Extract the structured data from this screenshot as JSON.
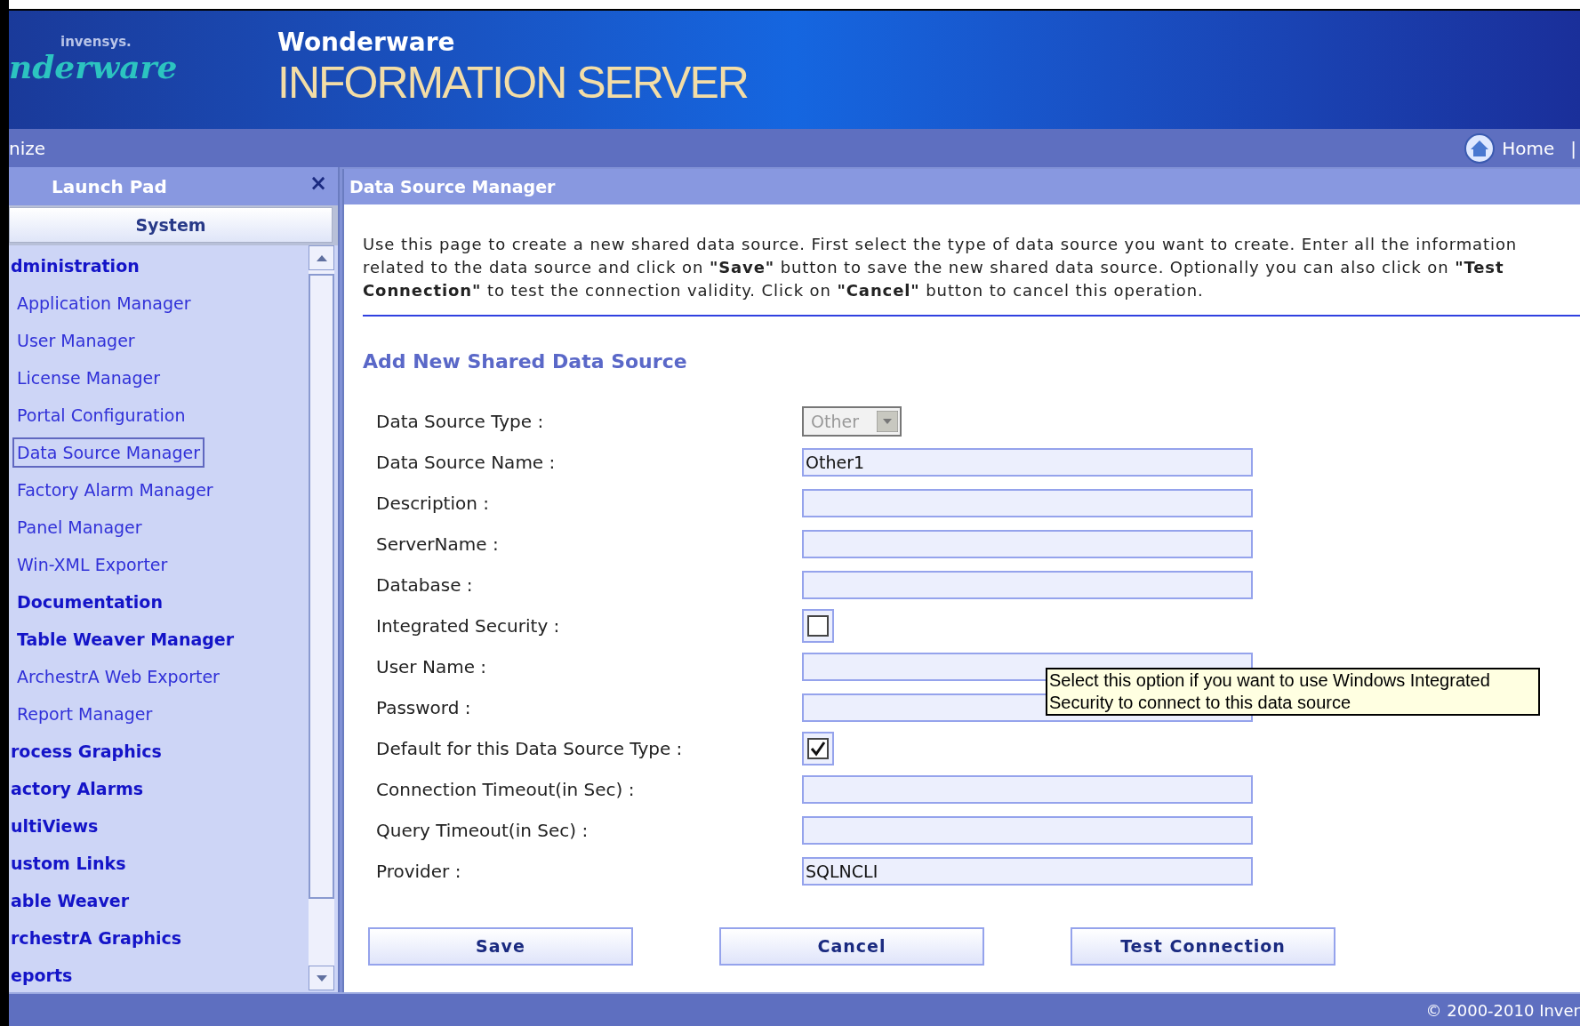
{
  "header": {
    "logo_company": "invensys.",
    "logo_brand": "nderware",
    "product_brand": "Wonderware",
    "product_name": "INFORMATION SERVER"
  },
  "nav_bar": {
    "left_text": "nize",
    "home_link": "Home",
    "separator": "|"
  },
  "launch_pad": {
    "title": "Launch Pad",
    "close": "×",
    "tab": "System",
    "tree": [
      {
        "label": "dministration",
        "selected": false,
        "children": [
          {
            "label": "Application Manager",
            "bold": false,
            "selected": false
          },
          {
            "label": "User Manager",
            "bold": false,
            "selected": false
          },
          {
            "label": "License Manager",
            "bold": false,
            "selected": false
          },
          {
            "label": "Portal Configuration",
            "bold": false,
            "selected": false
          },
          {
            "label": "Data Source Manager",
            "bold": false,
            "selected": true
          },
          {
            "label": "Factory Alarm Manager",
            "bold": false,
            "selected": false
          },
          {
            "label": "Panel Manager",
            "bold": false,
            "selected": false
          },
          {
            "label": "Win-XML Exporter",
            "bold": false,
            "selected": false
          },
          {
            "label": "Documentation",
            "bold": true,
            "selected": false
          },
          {
            "label": "Table Weaver Manager",
            "bold": true,
            "selected": false
          },
          {
            "label": "ArchestrA Web Exporter",
            "bold": false,
            "selected": false
          },
          {
            "label": "Report Manager",
            "bold": false,
            "selected": false
          }
        ]
      },
      {
        "label": "rocess Graphics",
        "selected": false
      },
      {
        "label": "actory Alarms",
        "selected": false
      },
      {
        "label": "ultiViews",
        "selected": false
      },
      {
        "label": "ustom Links",
        "selected": false
      },
      {
        "label": "able Weaver",
        "selected": false
      },
      {
        "label": "rchestrA Graphics",
        "selected": false
      },
      {
        "label": "eports",
        "selected": false
      }
    ]
  },
  "content": {
    "title": "Data Source Manager",
    "description": "Use this page to create a new shared data source. First select the type of data source you want to create. Enter all the information related to the data source and click on **\"Save\"** button to save the new shared data source. Optionally you can also click on **\"Test Connection\"** to test the connection validity. Click on **\"Cancel\"** button to cancel this operation.",
    "form_title": "Add New Shared Data Source",
    "fields": [
      {
        "label": "Data Source Type :",
        "kind": "select",
        "value": "Other",
        "disabled": true
      },
      {
        "label": "Data Source Name :",
        "kind": "text",
        "value": "Other1"
      },
      {
        "label": "Description :",
        "kind": "text"
      },
      {
        "label": "ServerName :",
        "kind": "text"
      },
      {
        "label": "Database :",
        "kind": "text"
      },
      {
        "label": "Integrated Security :",
        "kind": "checkbox",
        "checked": false
      },
      {
        "label": "User Name :",
        "kind": "text"
      },
      {
        "label": "Password :",
        "kind": "text"
      },
      {
        "label": "Default for this Data Source Type :",
        "kind": "checkbox",
        "checked": true
      },
      {
        "label": "Connection Timeout(in Sec) :",
        "kind": "text"
      },
      {
        "label": "Query Timeout(in Sec) :",
        "kind": "text"
      },
      {
        "label": "Provider :",
        "kind": "text",
        "value": "SQLNCLI"
      }
    ],
    "tooltip": {
      "lines": [
        "Select this option if you want to use Windows Integrated",
        "Security to connect to this data source"
      ]
    },
    "buttons": [
      "Save",
      "Cancel",
      "Test Connection"
    ]
  },
  "footer": {
    "copyright": "© 2000-2010 Inver"
  }
}
